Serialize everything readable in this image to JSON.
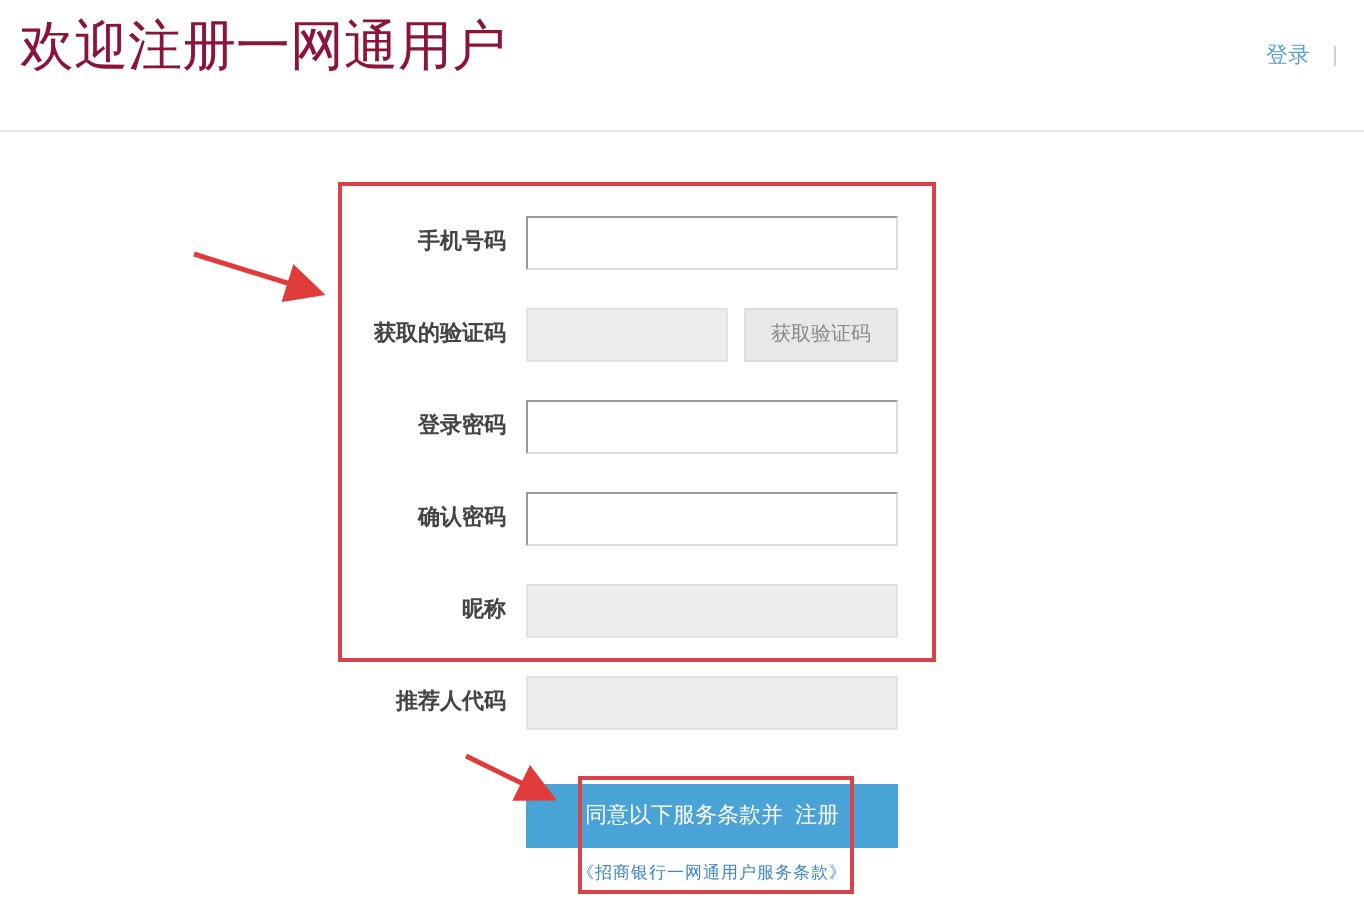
{
  "header": {
    "title": "欢迎注册一网通用户",
    "links": [
      {
        "label": "登录"
      }
    ]
  },
  "form": {
    "fields": [
      {
        "label": "手机号码",
        "disabled": false
      },
      {
        "label": "获取的验证码",
        "disabled": true,
        "button": "获取验证码"
      },
      {
        "label": "登录密码",
        "disabled": false
      },
      {
        "label": "确认密码",
        "disabled": false
      },
      {
        "label": "昵称",
        "disabled": true
      },
      {
        "label": "推荐人代码",
        "disabled": true
      }
    ],
    "submit": "同意以下服务条款并  注册",
    "terms_link": "《招商银行一网通用户服务条款》"
  }
}
